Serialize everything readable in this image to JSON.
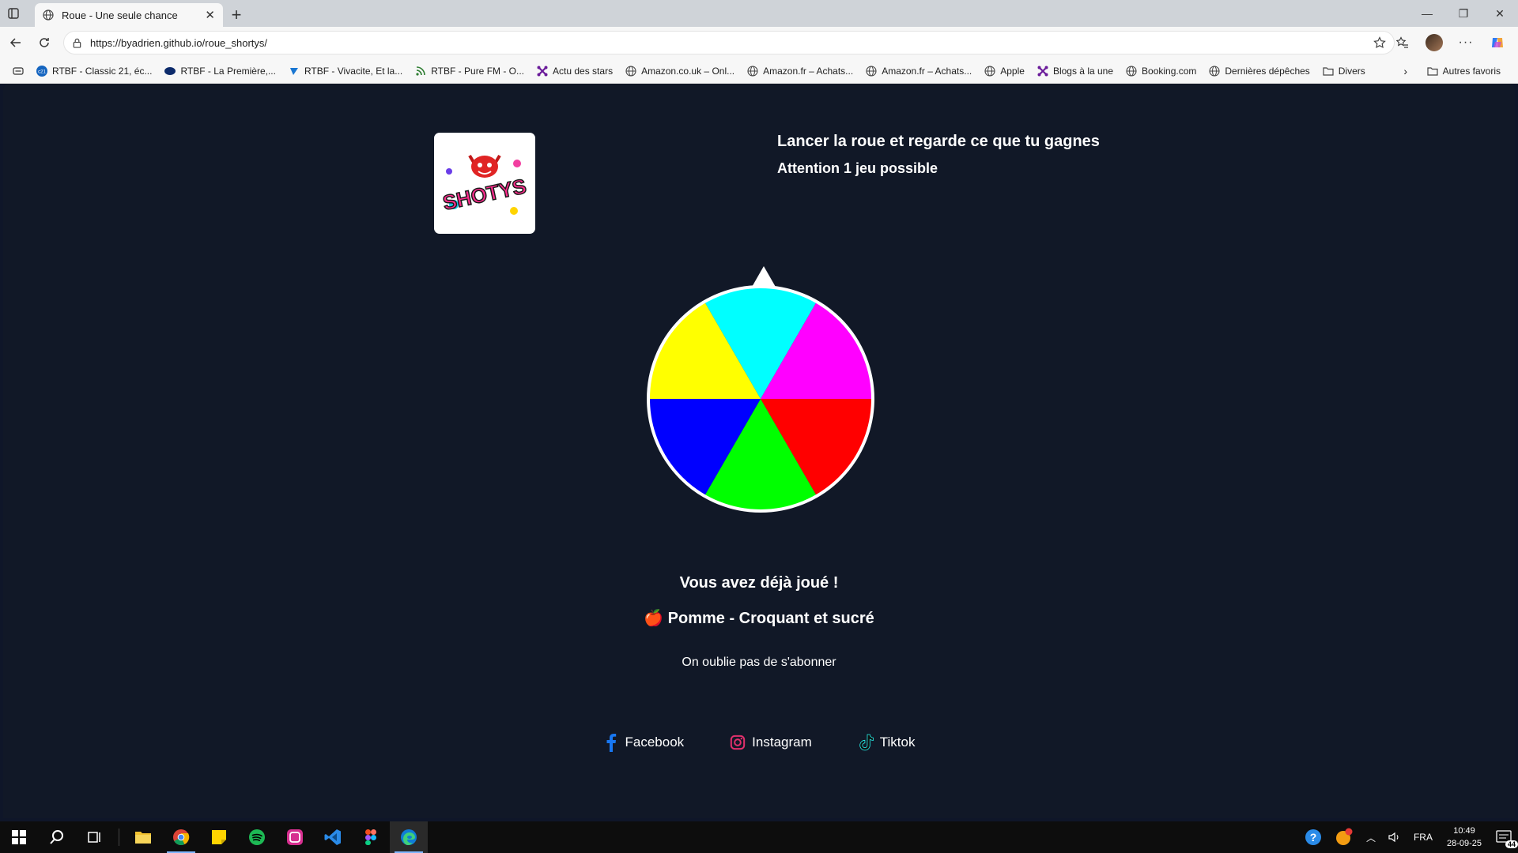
{
  "browser": {
    "tab_title": "Roue - Une seule chance",
    "url": "https://byadrien.github.io/roue_shortys/",
    "bookmarks": [
      {
        "label": "RTBF - Classic 21, éc...",
        "icon": "rtbf-icon"
      },
      {
        "label": "RTBF - La Première,...",
        "icon": "rtbf-icon"
      },
      {
        "label": "RTBF - Vivacite, Et la...",
        "icon": "vivacite-icon"
      },
      {
        "label": "RTBF - Pure FM - O...",
        "icon": "rss-icon"
      },
      {
        "label": "Actu des stars",
        "icon": "puzzle-icon"
      },
      {
        "label": "Amazon.co.uk – Onl...",
        "icon": "globe-icon"
      },
      {
        "label": "Amazon.fr – Achats...",
        "icon": "globe-icon"
      },
      {
        "label": "Amazon.fr – Achats...",
        "icon": "globe-icon"
      },
      {
        "label": "Apple",
        "icon": "globe-icon"
      },
      {
        "label": "Blogs à la une",
        "icon": "puzzle-icon"
      },
      {
        "label": "Booking.com",
        "icon": "globe-icon"
      },
      {
        "label": "Dernières dépêches",
        "icon": "globe-icon"
      },
      {
        "label": "Divers",
        "icon": "folder-icon"
      }
    ],
    "other_favorites": "Autres favoris"
  },
  "page": {
    "logo_text": "SHOTYS",
    "intro_line1": "Lancer la roue et regarde ce que tu gagnes",
    "intro_line2": "Attention 1 jeu possible",
    "wheel_segments": [
      {
        "color": "#00ffff"
      },
      {
        "color": "#ff00ff"
      },
      {
        "color": "#ff0000"
      },
      {
        "color": "#00ff00"
      },
      {
        "color": "#0000ff"
      },
      {
        "color": "#ffff00"
      }
    ],
    "result_title": "Vous avez déjà joué !",
    "prize_emoji": "🍎",
    "prize_text": "Pomme - Croquant et sucré",
    "subscribe_text": "On oublie pas de s'abonner",
    "socials": [
      {
        "label": "Facebook",
        "icon": "facebook-icon"
      },
      {
        "label": "Instagram",
        "icon": "instagram-icon"
      },
      {
        "label": "Tiktok",
        "icon": "tiktok-icon"
      }
    ]
  },
  "taskbar": {
    "language": "FRA",
    "time": "10:49",
    "date": "28-09-25",
    "notification_count": "44"
  },
  "colors": {
    "page_bg": "#111827",
    "text": "#ffffff",
    "facebook": "#1877f2",
    "instagram": "#e1306c"
  }
}
